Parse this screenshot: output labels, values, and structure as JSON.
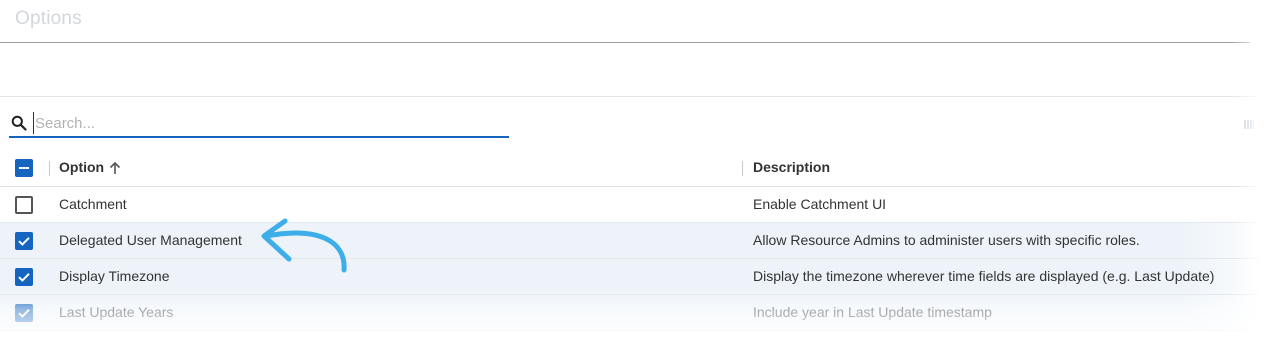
{
  "page": {
    "title": "Options"
  },
  "search": {
    "placeholder": "Search...",
    "value": ""
  },
  "table": {
    "columns": {
      "option": "Option",
      "description": "Description"
    },
    "sort": {
      "column": "Option",
      "direction": "ascending"
    },
    "select_all_state": "partial",
    "rows": [
      {
        "option": "Catchment",
        "description": "Enable Catchment UI",
        "checked": false
      },
      {
        "option": "Delegated User Management",
        "description": "Allow Resource Admins to administer users with specific roles.",
        "checked": true
      },
      {
        "option": "Display Timezone",
        "description": "Display the timezone wherever time fields are displayed (e.g. Last Update)",
        "checked": true
      },
      {
        "option": "Last Update Years",
        "description": "Include year in Last Update timestamp",
        "checked": true
      }
    ]
  },
  "colors": {
    "accent": "#1565c0",
    "selected_row": "#edf3f9",
    "arrow": "#3daee9"
  },
  "icons": {
    "search": "search-icon",
    "sort": "arrow-up-icon",
    "annotation": "curved-arrow-icon"
  }
}
